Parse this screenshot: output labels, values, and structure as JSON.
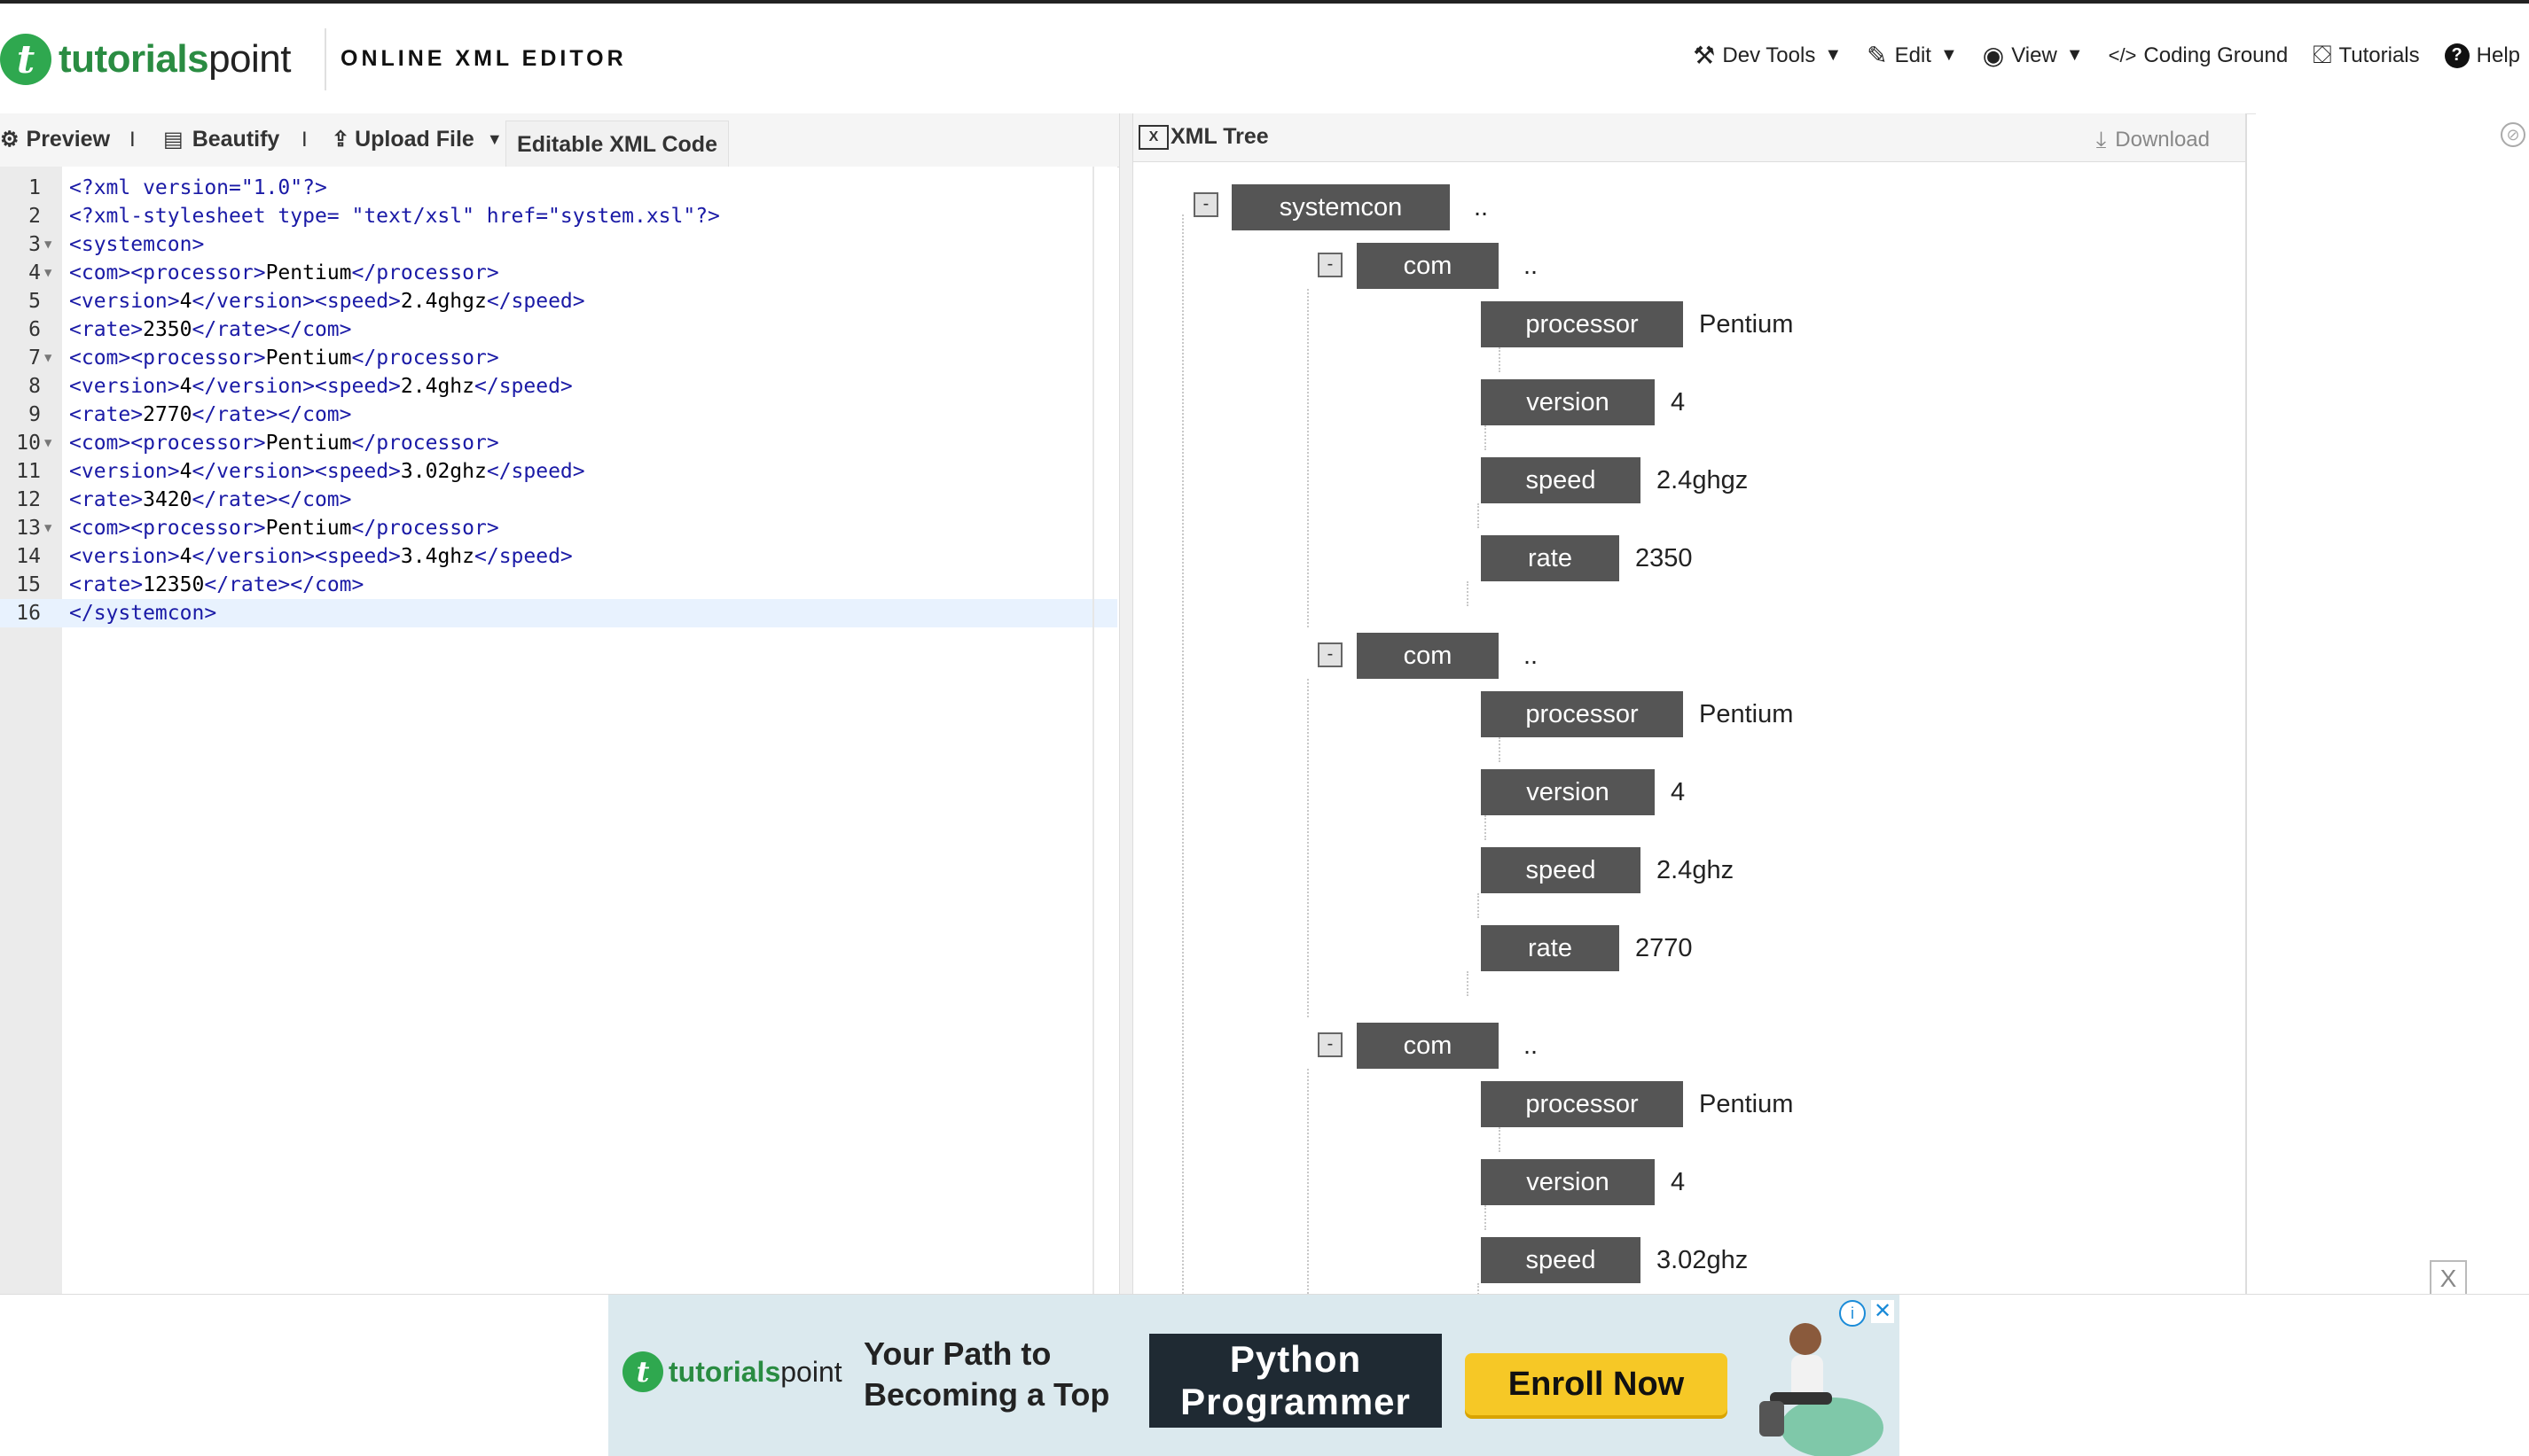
{
  "header": {
    "logo_mark": "t",
    "logo_text_main": "tutorials",
    "logo_text_sub": "point",
    "app_title": "ONLINE XML EDITOR",
    "nav": [
      {
        "label": "Dev Tools",
        "icon": "tools-icon",
        "has_caret": true
      },
      {
        "label": "Edit",
        "icon": "edit-icon",
        "has_caret": true
      },
      {
        "label": "View",
        "icon": "eye-icon",
        "has_caret": true
      },
      {
        "label": "Coding Ground",
        "icon": "code-icon",
        "has_caret": false
      },
      {
        "label": "Tutorials",
        "icon": "tutorials-icon",
        "has_caret": false
      },
      {
        "label": "Help",
        "icon": "help-icon",
        "has_caret": false
      }
    ]
  },
  "toolbar": {
    "preview": "Preview",
    "separator": "I",
    "beautify": "Beautify",
    "upload": "Upload File",
    "active_tab": "Editable XML Code"
  },
  "editor": {
    "active_line": 16,
    "lines": [
      {
        "n": "1",
        "text": "<?xml version=\"1.0\"?>"
      },
      {
        "n": "2",
        "text": "<?xml-stylesheet type= \"text/xsl\" href=\"system.xsl\"?>"
      },
      {
        "n": "3",
        "text": "<systemcon>",
        "fold": true
      },
      {
        "n": "4",
        "text": "<com><processor>Pentium</processor>",
        "fold": true
      },
      {
        "n": "5",
        "text": "<version>4</version><speed>2.4ghgz</speed>"
      },
      {
        "n": "6",
        "text": "<rate>2350</rate></com>"
      },
      {
        "n": "7",
        "text": "<com><processor>Pentium</processor>",
        "fold": true
      },
      {
        "n": "8",
        "text": "<version>4</version><speed>2.4ghz</speed>"
      },
      {
        "n": "9",
        "text": "<rate>2770</rate></com>"
      },
      {
        "n": "10",
        "text": "<com><processor>Pentium</processor>",
        "fold": true
      },
      {
        "n": "11",
        "text": "<version>4</version><speed>3.02ghz</speed>"
      },
      {
        "n": "12",
        "text": "<rate>3420</rate></com>"
      },
      {
        "n": "13",
        "text": "<com><processor>Pentium</processor>",
        "fold": true
      },
      {
        "n": "14",
        "text": "<version>4</version><speed>3.4ghz</speed>"
      },
      {
        "n": "15",
        "text": "<rate>12350</rate></com>"
      },
      {
        "n": "16",
        "text": "</systemcon>"
      }
    ]
  },
  "tree": {
    "title": "XML Tree",
    "download": "Download",
    "collapse_symbol": "-",
    "root": {
      "name": "systemcon",
      "value": ".."
    },
    "coms": [
      {
        "name": "com",
        "value": "..",
        "children": [
          {
            "name": "processor",
            "value": "Pentium"
          },
          {
            "name": "version",
            "value": "4"
          },
          {
            "name": "speed",
            "value": "2.4ghgz"
          },
          {
            "name": "rate",
            "value": "2350"
          }
        ]
      },
      {
        "name": "com",
        "value": "..",
        "children": [
          {
            "name": "processor",
            "value": "Pentium"
          },
          {
            "name": "version",
            "value": "4"
          },
          {
            "name": "speed",
            "value": "2.4ghz"
          },
          {
            "name": "rate",
            "value": "2770"
          }
        ]
      },
      {
        "name": "com",
        "value": "..",
        "children": [
          {
            "name": "processor",
            "value": "Pentium"
          },
          {
            "name": "version",
            "value": "4"
          },
          {
            "name": "speed",
            "value": "3.02ghz"
          }
        ]
      }
    ]
  },
  "side": {
    "close_label": "X"
  },
  "ad": {
    "logo_main": "tutorials",
    "logo_sub": "point",
    "tagline": "Your Path to Becoming a Top",
    "headline": "Python Programmer",
    "cta": "Enroll Now",
    "info_symbol": "i",
    "close_symbol": "✕"
  },
  "colors": {
    "brand_green": "#2fa84f",
    "node_bg": "#555555",
    "tag_blue": "#1a1aa6",
    "active_line": "#e8f2fe",
    "cta_yellow": "#f6c826"
  }
}
